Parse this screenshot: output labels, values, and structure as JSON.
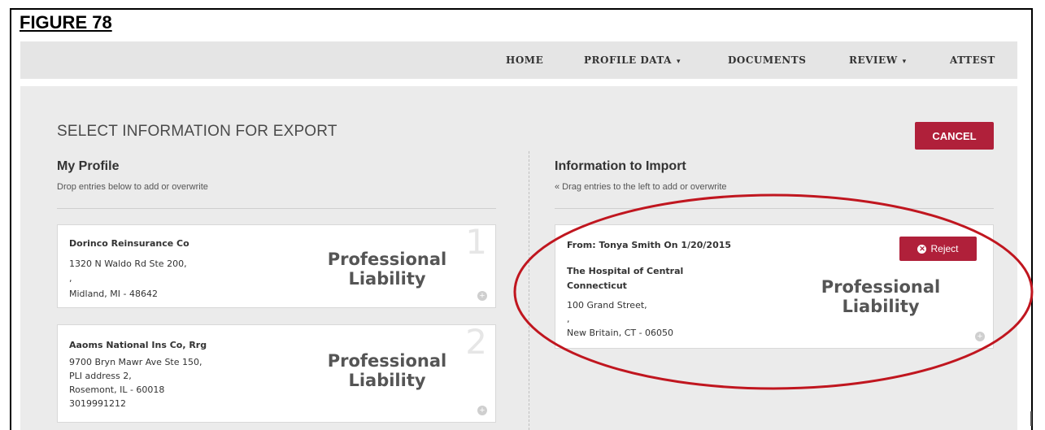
{
  "figure_label": "FIGURE 78",
  "nav": {
    "home": "HOME",
    "profile_data": "PROFILE DATA",
    "documents": "DOCUMENTS",
    "review": "REVIEW",
    "attest": "ATTEST",
    "caret": "▾"
  },
  "page": {
    "title": "SELECT INFORMATION FOR EXPORT",
    "cancel_label": "CANCEL"
  },
  "my_profile": {
    "heading": "My Profile",
    "subheading": "Drop entries below to add or overwrite",
    "cards": [
      {
        "number": "1",
        "name": "Dorinco Reinsurance Co",
        "address1": "1320 N Waldo Rd Ste 200,",
        "address2": ",",
        "city_line": "Midland, MI - 48642",
        "type_line1": "Professional",
        "type_line2": "Liability"
      },
      {
        "number": "2",
        "name": "Aaoms National Ins Co, Rrg",
        "address1": "9700 Bryn Mawr Ave Ste 150,",
        "address2": "PLI address 2,",
        "city_line": "Rosemont, IL - 60018",
        "phone": "3019991212",
        "type_line1": "Professional",
        "type_line2": "Liability"
      }
    ]
  },
  "import": {
    "heading": "Information to Import",
    "subheading": "« Drag entries to the left to add or overwrite",
    "card": {
      "from": "From: Tonya Smith On 1/20/2015",
      "reject_label": "Reject",
      "name_line1": "The Hospital of Central",
      "name_line2": "Connecticut",
      "address1": "100 Grand Street,",
      "address2": ",",
      "city_line": "New Britain, CT - 06050",
      "type_line1": "Professional",
      "type_line2": "Liability"
    }
  },
  "colors": {
    "accent": "#b0203a",
    "annotation": "#c0161f",
    "navbar_bg": "#e5e5e5",
    "content_bg": "#ebebeb"
  },
  "icons": [
    "chevron-down-icon",
    "add-circle-icon",
    "close-circle-icon"
  ]
}
